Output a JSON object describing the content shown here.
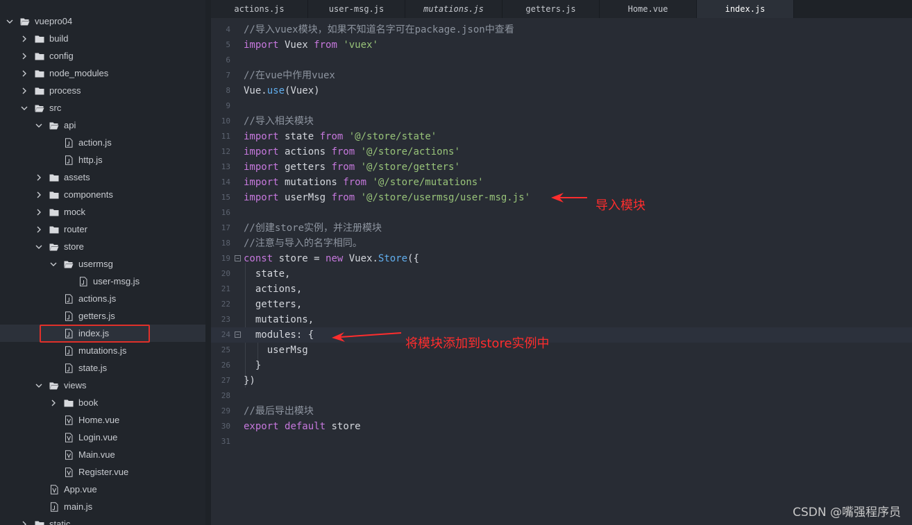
{
  "project_root": "vuepro04",
  "tree": [
    {
      "label": "vuepro04",
      "depth": 0,
      "type": "folder-open",
      "expanded": true
    },
    {
      "label": "build",
      "depth": 1,
      "type": "folder",
      "expanded": false
    },
    {
      "label": "config",
      "depth": 1,
      "type": "folder",
      "expanded": false
    },
    {
      "label": "node_modules",
      "depth": 1,
      "type": "folder",
      "expanded": false
    },
    {
      "label": "process",
      "depth": 1,
      "type": "folder",
      "expanded": false
    },
    {
      "label": "src",
      "depth": 1,
      "type": "folder-open",
      "expanded": true
    },
    {
      "label": "api",
      "depth": 2,
      "type": "folder-open",
      "expanded": true
    },
    {
      "label": "action.js",
      "depth": 3,
      "type": "js"
    },
    {
      "label": "http.js",
      "depth": 3,
      "type": "js"
    },
    {
      "label": "assets",
      "depth": 2,
      "type": "folder",
      "expanded": false
    },
    {
      "label": "components",
      "depth": 2,
      "type": "folder",
      "expanded": false
    },
    {
      "label": "mock",
      "depth": 2,
      "type": "folder",
      "expanded": false
    },
    {
      "label": "router",
      "depth": 2,
      "type": "folder",
      "expanded": false
    },
    {
      "label": "store",
      "depth": 2,
      "type": "folder-open",
      "expanded": true
    },
    {
      "label": "usermsg",
      "depth": 3,
      "type": "folder-open",
      "expanded": true
    },
    {
      "label": "user-msg.js",
      "depth": 4,
      "type": "js"
    },
    {
      "label": "actions.js",
      "depth": 3,
      "type": "js"
    },
    {
      "label": "getters.js",
      "depth": 3,
      "type": "js"
    },
    {
      "label": "index.js",
      "depth": 3,
      "type": "js",
      "selected": true
    },
    {
      "label": "mutations.js",
      "depth": 3,
      "type": "js"
    },
    {
      "label": "state.js",
      "depth": 3,
      "type": "js"
    },
    {
      "label": "views",
      "depth": 2,
      "type": "folder-open",
      "expanded": true
    },
    {
      "label": "book",
      "depth": 3,
      "type": "folder",
      "expanded": false
    },
    {
      "label": "Home.vue",
      "depth": 3,
      "type": "vue"
    },
    {
      "label": "Login.vue",
      "depth": 3,
      "type": "vue"
    },
    {
      "label": "Main.vue",
      "depth": 3,
      "type": "vue"
    },
    {
      "label": "Register.vue",
      "depth": 3,
      "type": "vue"
    },
    {
      "label": "App.vue",
      "depth": 2,
      "type": "vue"
    },
    {
      "label": "main.js",
      "depth": 2,
      "type": "js"
    },
    {
      "label": "static",
      "depth": 1,
      "type": "folder",
      "expanded": false
    }
  ],
  "tabs": [
    {
      "label": "actions.js",
      "italic": false,
      "active": false
    },
    {
      "label": "user-msg.js",
      "italic": false,
      "active": false
    },
    {
      "label": "mutations.js",
      "italic": true,
      "active": false
    },
    {
      "label": "getters.js",
      "italic": false,
      "active": false
    },
    {
      "label": "Home.vue",
      "italic": false,
      "active": false
    },
    {
      "label": "index.js",
      "italic": false,
      "active": true
    }
  ],
  "code_lines": [
    {
      "n": "4",
      "tokens": [
        [
          "cm",
          "//导入vuex模块，如果不知道名字可在package.json中查看"
        ]
      ]
    },
    {
      "n": "5",
      "tokens": [
        [
          "kw",
          "import"
        ],
        [
          "plain",
          " Vuex "
        ],
        [
          "kw",
          "from"
        ],
        [
          "plain",
          " "
        ],
        [
          "str",
          "'vuex'"
        ]
      ]
    },
    {
      "n": "6",
      "tokens": []
    },
    {
      "n": "7",
      "tokens": [
        [
          "cm",
          "//在vue中作用vuex"
        ]
      ]
    },
    {
      "n": "8",
      "tokens": [
        [
          "plain",
          "Vue."
        ],
        [
          "fn",
          "use"
        ],
        [
          "plain",
          "(Vuex)"
        ]
      ]
    },
    {
      "n": "9",
      "tokens": []
    },
    {
      "n": "10",
      "tokens": [
        [
          "cm",
          "//导入相关模块"
        ]
      ]
    },
    {
      "n": "11",
      "tokens": [
        [
          "kw",
          "import"
        ],
        [
          "plain",
          " state "
        ],
        [
          "kw",
          "from"
        ],
        [
          "plain",
          " "
        ],
        [
          "str",
          "'@/store/state'"
        ]
      ]
    },
    {
      "n": "12",
      "tokens": [
        [
          "kw",
          "import"
        ],
        [
          "plain",
          " actions "
        ],
        [
          "kw",
          "from"
        ],
        [
          "plain",
          " "
        ],
        [
          "str",
          "'@/store/actions'"
        ]
      ]
    },
    {
      "n": "13",
      "tokens": [
        [
          "kw",
          "import"
        ],
        [
          "plain",
          " getters "
        ],
        [
          "kw",
          "from"
        ],
        [
          "plain",
          " "
        ],
        [
          "str",
          "'@/store/getters'"
        ]
      ]
    },
    {
      "n": "14",
      "tokens": [
        [
          "kw",
          "import"
        ],
        [
          "plain",
          " mutations "
        ],
        [
          "kw",
          "from"
        ],
        [
          "plain",
          " "
        ],
        [
          "str",
          "'@/store/mutations'"
        ]
      ]
    },
    {
      "n": "15",
      "tokens": [
        [
          "kw",
          "import"
        ],
        [
          "plain",
          " userMsg "
        ],
        [
          "kw",
          "from"
        ],
        [
          "plain",
          " "
        ],
        [
          "str",
          "'@/store/usermsg/user-msg.js'"
        ]
      ]
    },
    {
      "n": "16",
      "tokens": []
    },
    {
      "n": "17",
      "tokens": [
        [
          "cm",
          "//创建store实例，并注册模块"
        ]
      ]
    },
    {
      "n": "18",
      "tokens": [
        [
          "cm",
          "//注意与导入的名字相同。"
        ]
      ]
    },
    {
      "n": "19",
      "fold": true,
      "tokens": [
        [
          "kw",
          "const"
        ],
        [
          "plain",
          " store = "
        ],
        [
          "kw",
          "new"
        ],
        [
          "plain",
          " Vuex."
        ],
        [
          "fn",
          "Store"
        ],
        [
          "plain",
          "({"
        ]
      ]
    },
    {
      "n": "20",
      "tokens": [
        [
          "plain",
          "  state,"
        ]
      ]
    },
    {
      "n": "21",
      "tokens": [
        [
          "plain",
          "  actions,"
        ]
      ]
    },
    {
      "n": "22",
      "tokens": [
        [
          "plain",
          "  getters,"
        ]
      ]
    },
    {
      "n": "23",
      "tokens": [
        [
          "plain",
          "  mutations,"
        ]
      ]
    },
    {
      "n": "24",
      "fold": true,
      "current": true,
      "tokens": [
        [
          "plain",
          "  modules: {"
        ]
      ]
    },
    {
      "n": "25",
      "tokens": [
        [
          "plain",
          "    userMsg"
        ]
      ]
    },
    {
      "n": "26",
      "tokens": [
        [
          "plain",
          "  }"
        ]
      ]
    },
    {
      "n": "27",
      "tokens": [
        [
          "plain",
          "})"
        ]
      ]
    },
    {
      "n": "28",
      "tokens": []
    },
    {
      "n": "29",
      "tokens": [
        [
          "cm",
          "//最后导出模块"
        ]
      ]
    },
    {
      "n": "30",
      "tokens": [
        [
          "kw",
          "export"
        ],
        [
          "plain",
          " "
        ],
        [
          "kw",
          "default"
        ],
        [
          "plain",
          " store"
        ]
      ]
    },
    {
      "n": "31",
      "tokens": []
    }
  ],
  "annotations": {
    "import_note": "导入模块",
    "modules_note": "将模块添加到store实例中"
  },
  "watermark": "CSDN @嘴强程序员",
  "colors": {
    "keyword": "#c678dd",
    "string": "#98c379",
    "function": "#61afef",
    "comment": "#8d949f",
    "annotation": "#ff2d2d"
  }
}
